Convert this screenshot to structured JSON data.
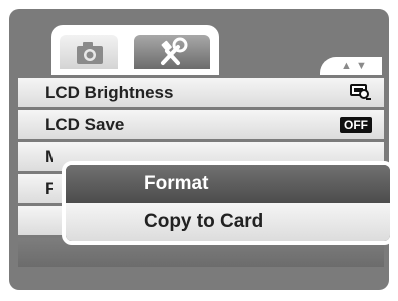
{
  "tabs": [
    {
      "name": "camera",
      "icon": "camera-icon",
      "selected": false
    },
    {
      "name": "setup",
      "icon": "wrench-screwdriver-icon",
      "selected": true
    }
  ],
  "scroll": {
    "up": "▲",
    "down": "▼"
  },
  "menu": {
    "items": [
      {
        "label": "LCD Brightness",
        "value_icon": "lcd-brightness-icon"
      },
      {
        "label": "LCD Save",
        "value": "OFF"
      },
      {
        "label": "M"
      },
      {
        "label": "F"
      }
    ]
  },
  "submenu": {
    "items": [
      {
        "label": "Format",
        "selected": true
      },
      {
        "label": "Copy to Card",
        "selected": false
      }
    ]
  },
  "colors": {
    "screen_bg": "#7b7b7b",
    "row_light": "#f0f0f0",
    "row_selected": "#5a5a5a",
    "frame": "#ffffff"
  }
}
